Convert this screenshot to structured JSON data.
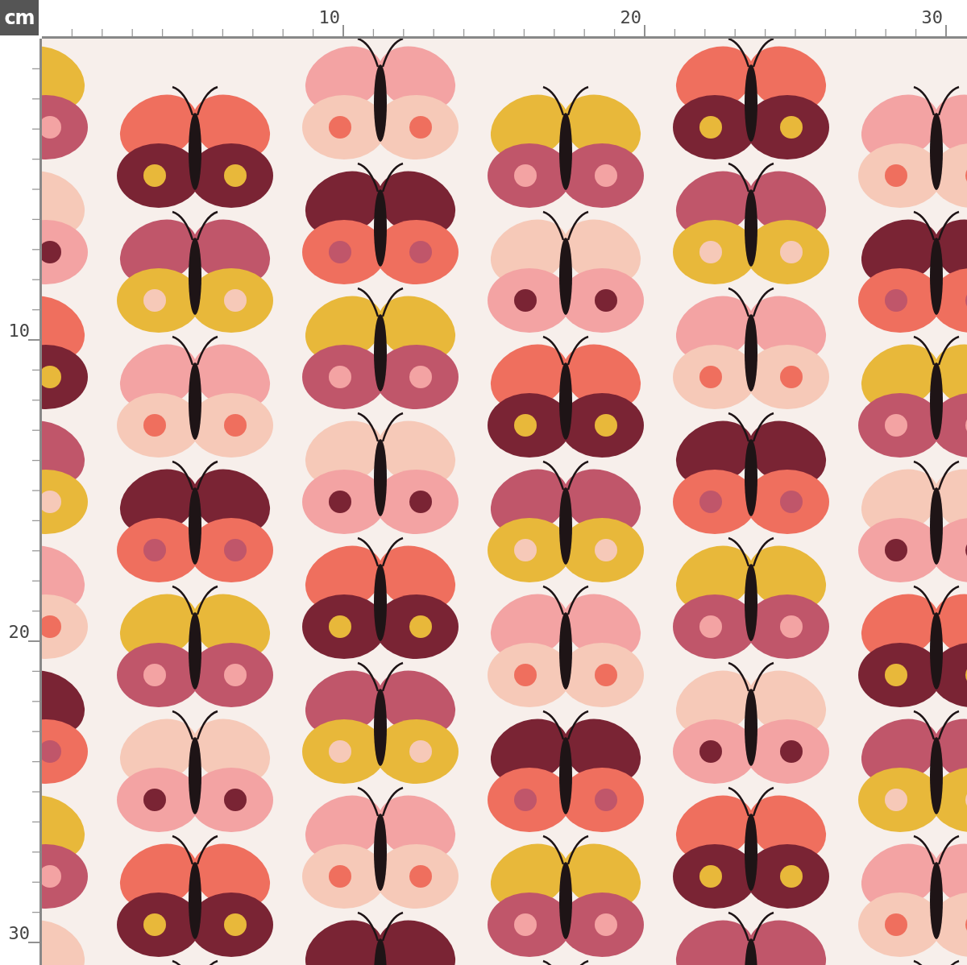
{
  "unit_label": "cm",
  "top_ruler": {
    "labels": [
      "10",
      "20",
      "30"
    ]
  },
  "left_ruler": {
    "labels": [
      "10",
      "20",
      "30"
    ]
  }
}
